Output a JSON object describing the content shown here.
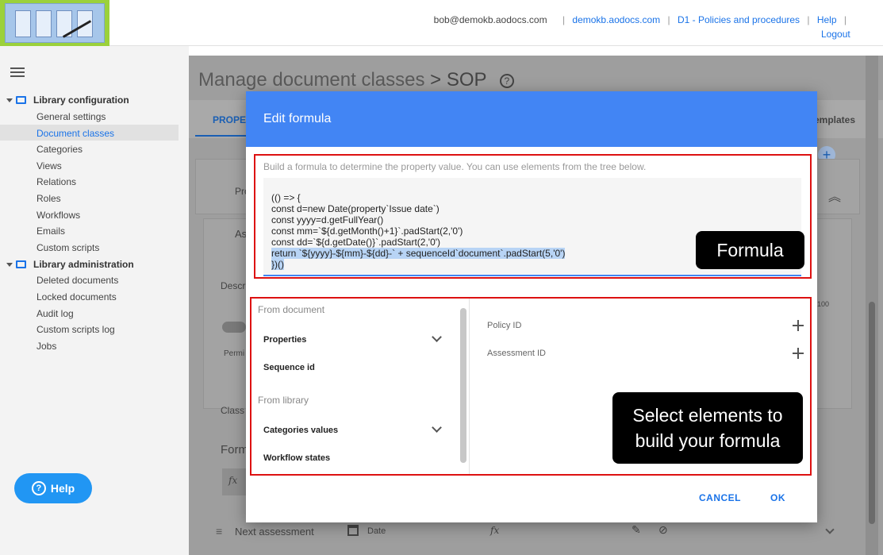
{
  "header": {
    "email": "bob@demokb.aodocs.com",
    "links": [
      "demokb.aodocs.com",
      "D1 - Policies and procedures",
      "Help"
    ],
    "logout": "Logout"
  },
  "sidebar": {
    "sections": [
      {
        "title": "Library configuration",
        "items": [
          "General settings",
          "Document classes",
          "Categories",
          "Views",
          "Relations",
          "Roles",
          "Workflows",
          "Emails",
          "Custom scripts"
        ]
      },
      {
        "title": "Library administration",
        "items": [
          "Deleted documents",
          "Locked documents",
          "Audit log",
          "Custom scripts log",
          "Jobs"
        ]
      }
    ],
    "active_item": "Document classes",
    "help_label": "Help"
  },
  "background": {
    "title": "Manage document classes",
    "title_suffix": "> SOP",
    "tab_properties": "PROPER",
    "tab_templates": "emplates",
    "fragments": {
      "pro": "Pro",
      "as": "As",
      "descr": "Descr",
      "perm": "Permi",
      "num": "100",
      "class": "Class",
      "form": "Form",
      "fx": "fx"
    },
    "bottom_row": {
      "name": "Next assessment",
      "type": "Date",
      "fx": "fx"
    }
  },
  "modal": {
    "title": "Edit formula",
    "hint": "Build a formula to determine the property value. You can use elements from the tree below.",
    "code_lines": [
      "(() => {",
      "const d=new Date(property`Issue date`)",
      "const yyyy=d.getFullYear()",
      "const mm=`${d.getMonth()+1}`.padStart(2,'0')",
      "const dd=`${d.getDate()}`.padStart(2,'0')",
      "return `${yyyy}-${mm}-${dd}-` + sequenceId`document`.padStart(5,'0')",
      "})()"
    ],
    "formula_callout": "Formula",
    "elements_callout": "Select elements to build your formula",
    "tree": {
      "from_document": "From document",
      "properties": "Properties",
      "sequence_id": "Sequence id",
      "from_library": "From library",
      "categories_values": "Categories values",
      "workflow_states": "Workflow states"
    },
    "properties_list": [
      "Policy ID",
      "Assessment ID"
    ],
    "cancel": "CANCEL",
    "ok": "OK"
  },
  "colors": {
    "accent": "#4285f4",
    "highlight": "#d11111",
    "logo_bg": "#9bd13b"
  }
}
